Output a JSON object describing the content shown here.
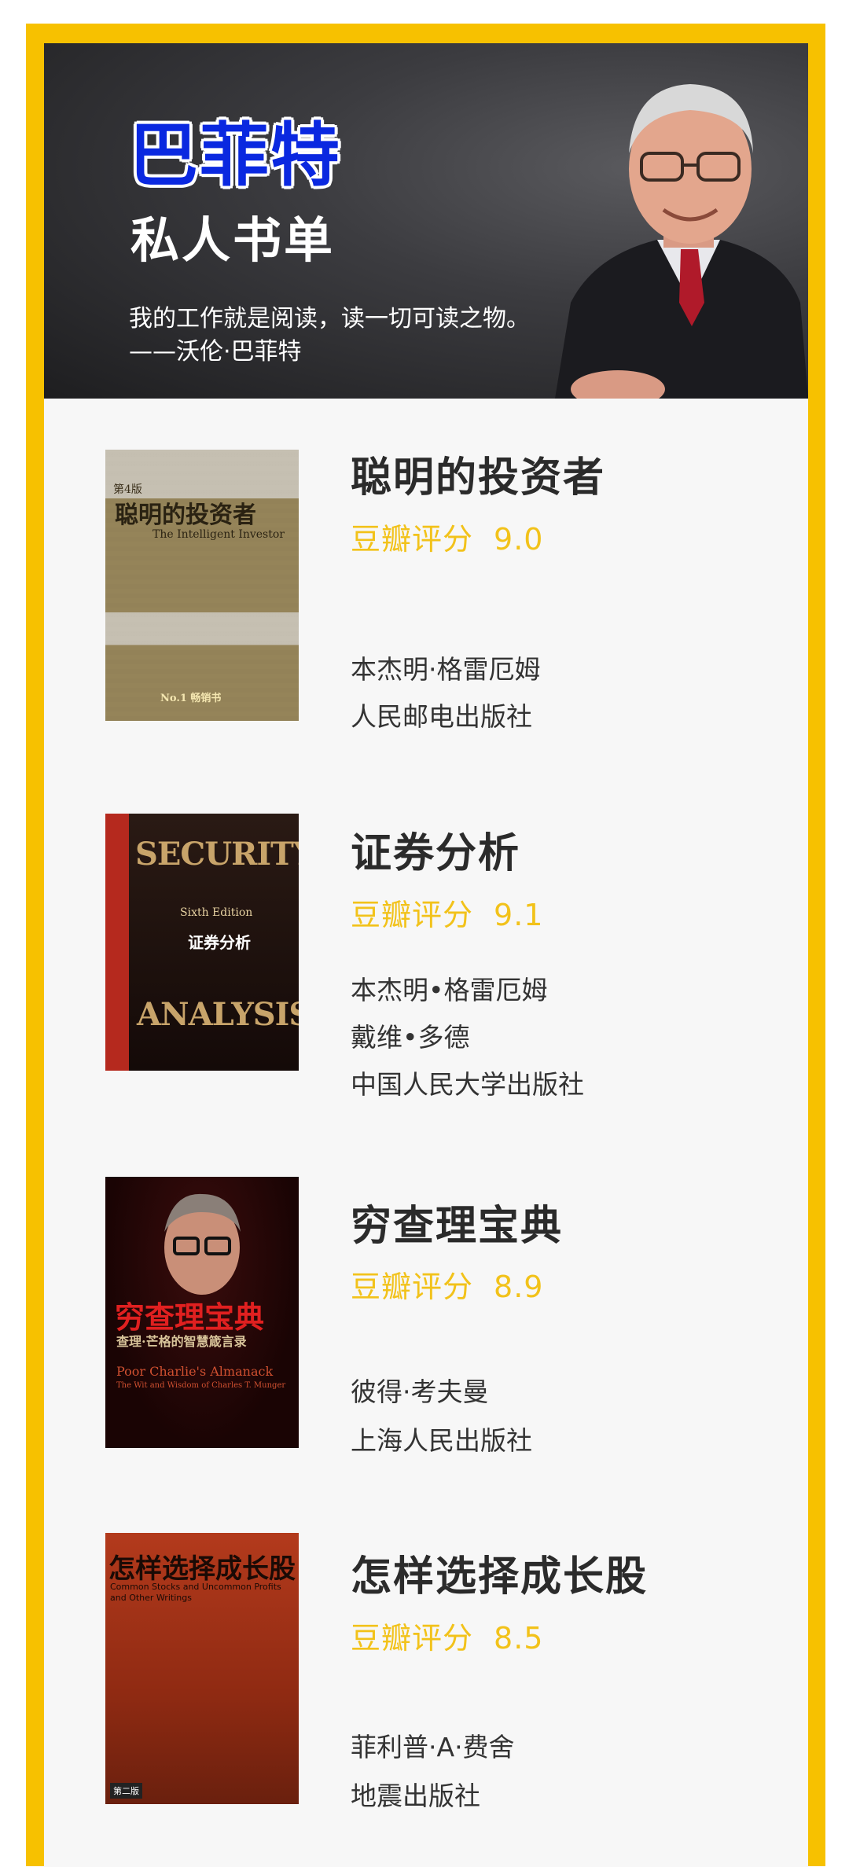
{
  "header": {
    "title": "巴菲特",
    "subtitle": "私人书单",
    "quote_line1": "我的工作就是阅读，读一切可读之物。",
    "quote_line2": "——沃伦·巴菲特"
  },
  "colors": {
    "frame": "#f7c100",
    "title_blue": "#0a28e0",
    "rating_yellow": "#f2c21a",
    "text_dark": "#2b2b2b"
  },
  "rating_label": "豆瓣评分",
  "books": [
    {
      "title": "聪明的投资者",
      "score": "9.0",
      "lines": [
        "本杰明·格雷厄姆",
        "人民邮电出版社"
      ],
      "cover": {
        "edition": "第4版",
        "title_cn": "聪明的投资者",
        "title_en": "The Intelligent Investor",
        "badge": "No.1 畅销书"
      }
    },
    {
      "title": "证券分析",
      "score": "9.1",
      "lines": [
        "本杰明•格雷厄姆",
        "戴维•多德",
        "中国人民大学出版社"
      ],
      "cover": {
        "top": "SECURITY",
        "edition": "Sixth Edition",
        "title_cn": "证券分析",
        "bottom": "ANALYSIS"
      }
    },
    {
      "title": "穷查理宝典",
      "score": "8.9",
      "lines": [
        "彼得·考夫曼",
        "上海人民出版社"
      ],
      "cover": {
        "title_cn": "穷查理宝典",
        "sub_cn": "查理·芒格的智慧箴言录",
        "title_en": "Poor Charlie's Almanack",
        "sub_en": "The Wit and Wisdom of Charles T. Munger"
      }
    },
    {
      "title": "怎样选择成长股",
      "score": "8.5",
      "lines": [
        "菲利普·A·费舍",
        "地震出版社"
      ],
      "cover": {
        "title_cn": "怎样选择成长股",
        "title_en": "Common Stocks and Uncommon Profits and Other Writings",
        "badge": "第二版"
      }
    }
  ]
}
